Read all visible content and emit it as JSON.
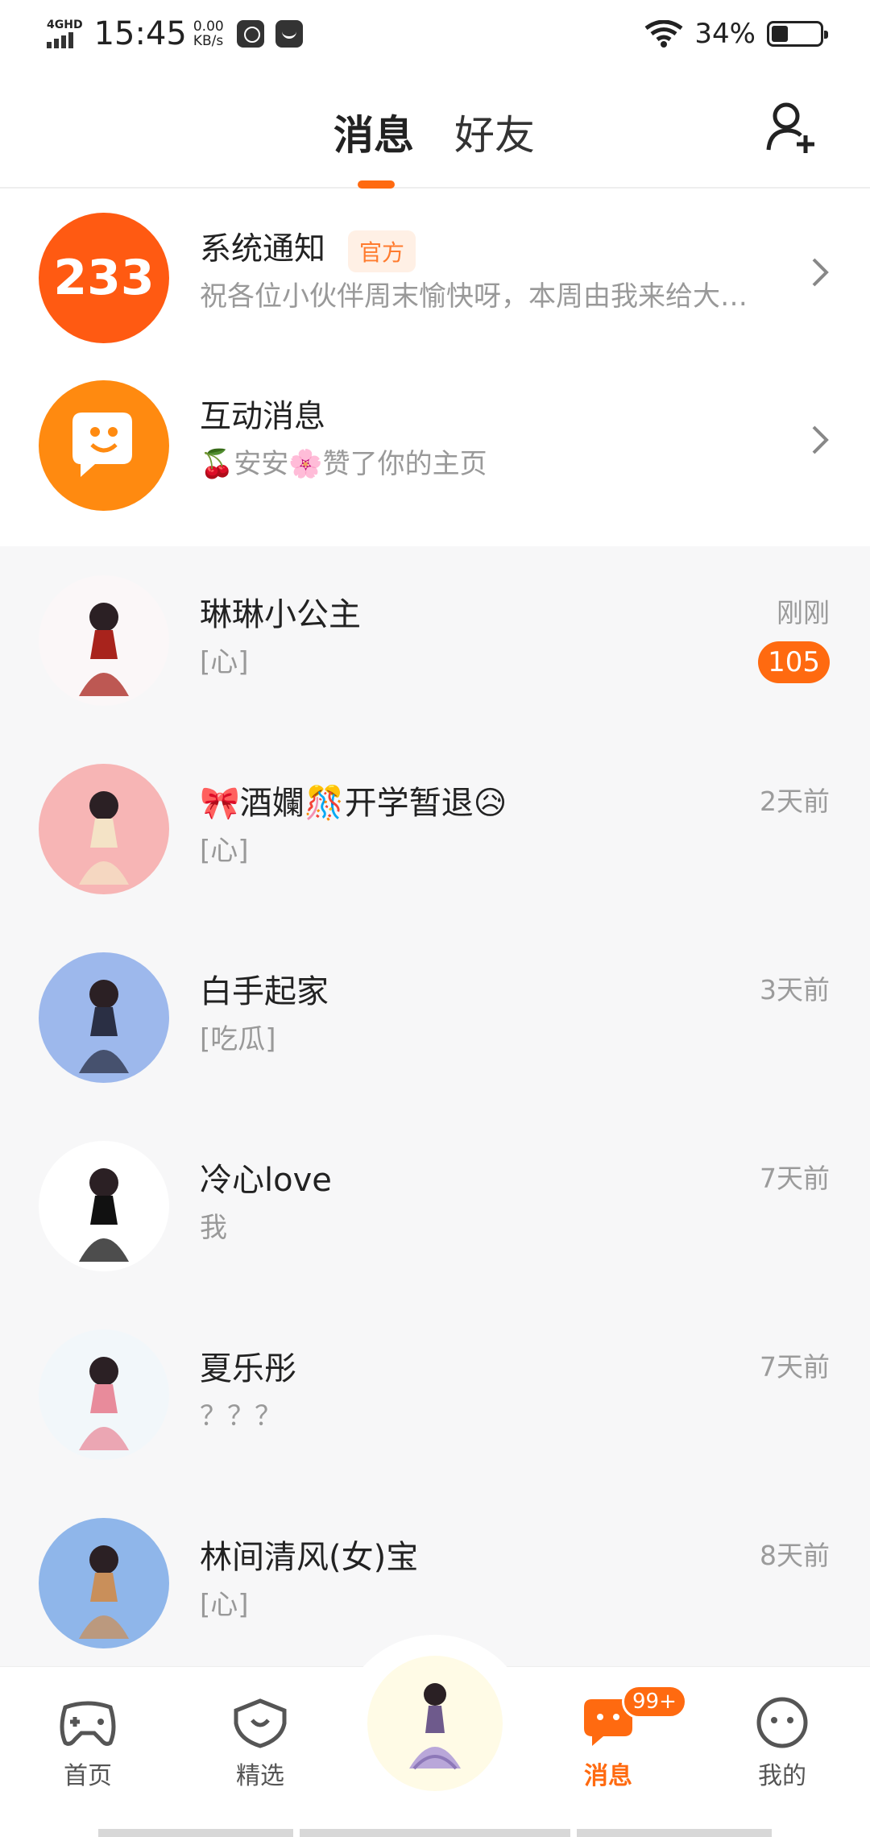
{
  "status_bar": {
    "network": "4GHD",
    "time": "15:45",
    "speed_value": "0.00",
    "speed_unit": "KB/s",
    "battery_percent": "34%",
    "battery_level": 0.34,
    "icons": [
      "signal-icon",
      "video-app-icon",
      "message-app-icon",
      "wifi-icon",
      "battery-icon"
    ]
  },
  "header": {
    "tabs": [
      {
        "label": "消息",
        "active": true
      },
      {
        "label": "好友",
        "active": false
      }
    ],
    "add_friend_icon": "add-user-icon"
  },
  "system_items": [
    {
      "title": "系统通知",
      "tag": "官方",
      "subtitle": "祝各位小伙伴周末愉快呀，本周由我来给大…",
      "avatar_text": "233",
      "avatar_color": "#ff5a12"
    },
    {
      "title": "互动消息",
      "subtitle": "🍒安安🌸赞了你的主页",
      "avatar_color": "#ff8a10"
    }
  ],
  "conversations": [
    {
      "name": "琳琳小公主",
      "message": "[心]",
      "time": "刚刚",
      "unread": "105",
      "avatar_bg": "#fbf7f8",
      "figure": "#a8231c"
    },
    {
      "name": "🎀酒孄🎊开学暂退😥",
      "message": "[心]",
      "time": "2天前",
      "unread": "",
      "avatar_bg": "#f7b5b5",
      "figure": "#f4e3c6"
    },
    {
      "name": "白手起家",
      "message": "[吃瓜]",
      "time": "3天前",
      "unread": "",
      "avatar_bg": "#9db8ec",
      "figure": "#2a2f44"
    },
    {
      "name": "冷心love",
      "message": "我",
      "time": "7天前",
      "unread": "",
      "avatar_bg": "#ffffff",
      "figure": "#111111"
    },
    {
      "name": "夏乐彤",
      "message": "？？？",
      "time": "7天前",
      "unread": "",
      "avatar_bg": "#f2f7fa",
      "figure": "#e88b9b"
    },
    {
      "name": "林间清风(女)宝",
      "message": "[心]",
      "time": "8天前",
      "unread": "",
      "avatar_bg": "#8fb6ea",
      "figure": "#c98f5a"
    }
  ],
  "bottom_nav": {
    "items": [
      {
        "label": "首页",
        "icon": "gamepad-icon",
        "active": false
      },
      {
        "label": "精选",
        "icon": "heart-shield-icon",
        "active": false
      },
      {
        "label": "消息",
        "icon": "chat-bubble-icon",
        "active": true,
        "badge": "99+"
      },
      {
        "label": "我的",
        "icon": "smiley-face-icon",
        "active": false
      }
    ]
  },
  "colors": {
    "accent": "#ff6a10",
    "list_bg": "#f7f7f8",
    "muted_text": "#999999"
  }
}
